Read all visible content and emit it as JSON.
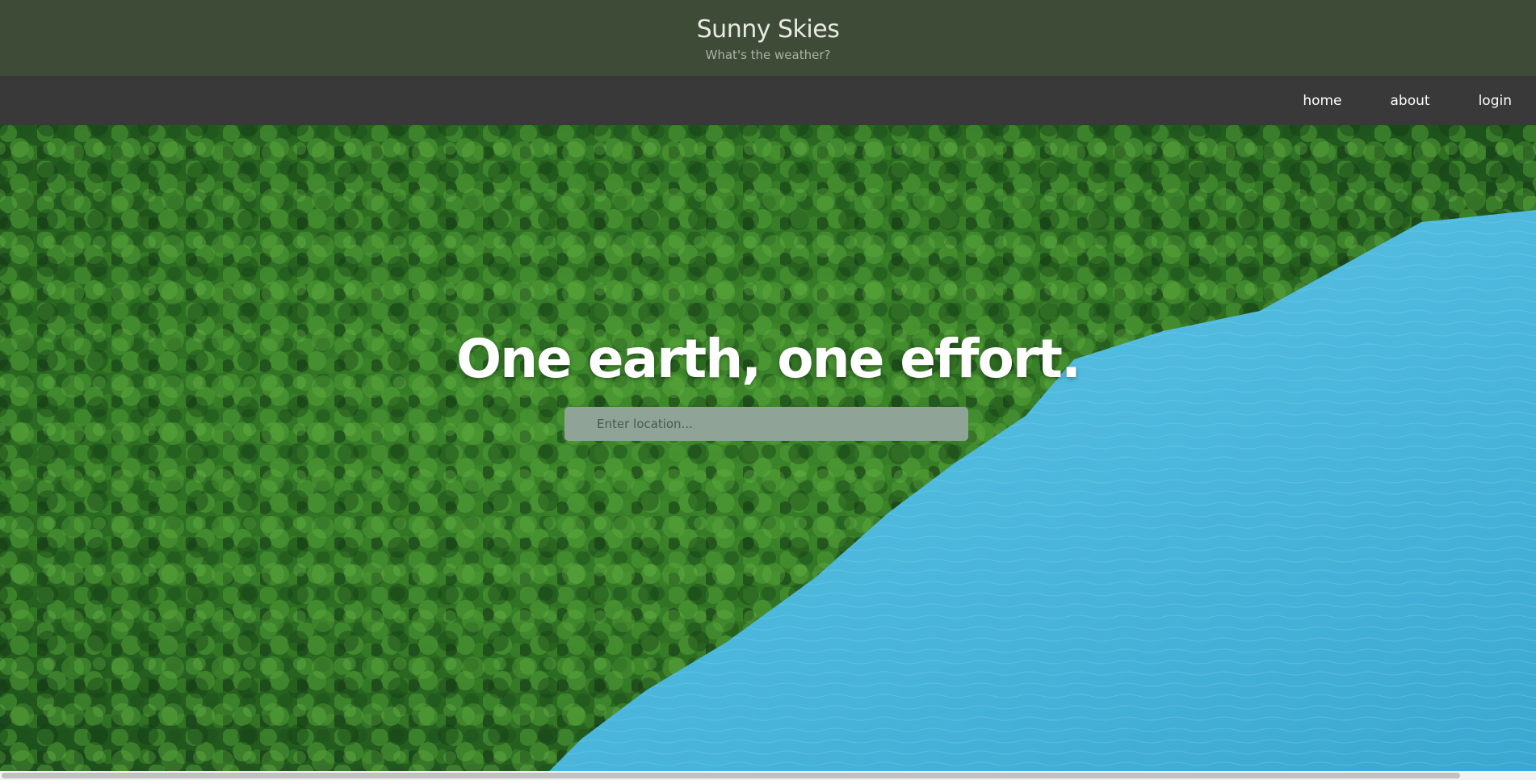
{
  "header": {
    "title": "Sunny Skies",
    "tagline": "What's the weather?"
  },
  "nav": {
    "items": [
      {
        "label": "home"
      },
      {
        "label": "about"
      },
      {
        "label": "login"
      }
    ]
  },
  "hero": {
    "headline": "One earth, one effort.",
    "search": {
      "placeholder": "Enter location...",
      "value": ""
    },
    "image": "aerial forest meeting turquoise lake"
  },
  "colors": {
    "header_bg": "#3e4b37",
    "nav_bg": "#393939",
    "search_bg": "#8fa497",
    "water": "#4fb4d6"
  }
}
